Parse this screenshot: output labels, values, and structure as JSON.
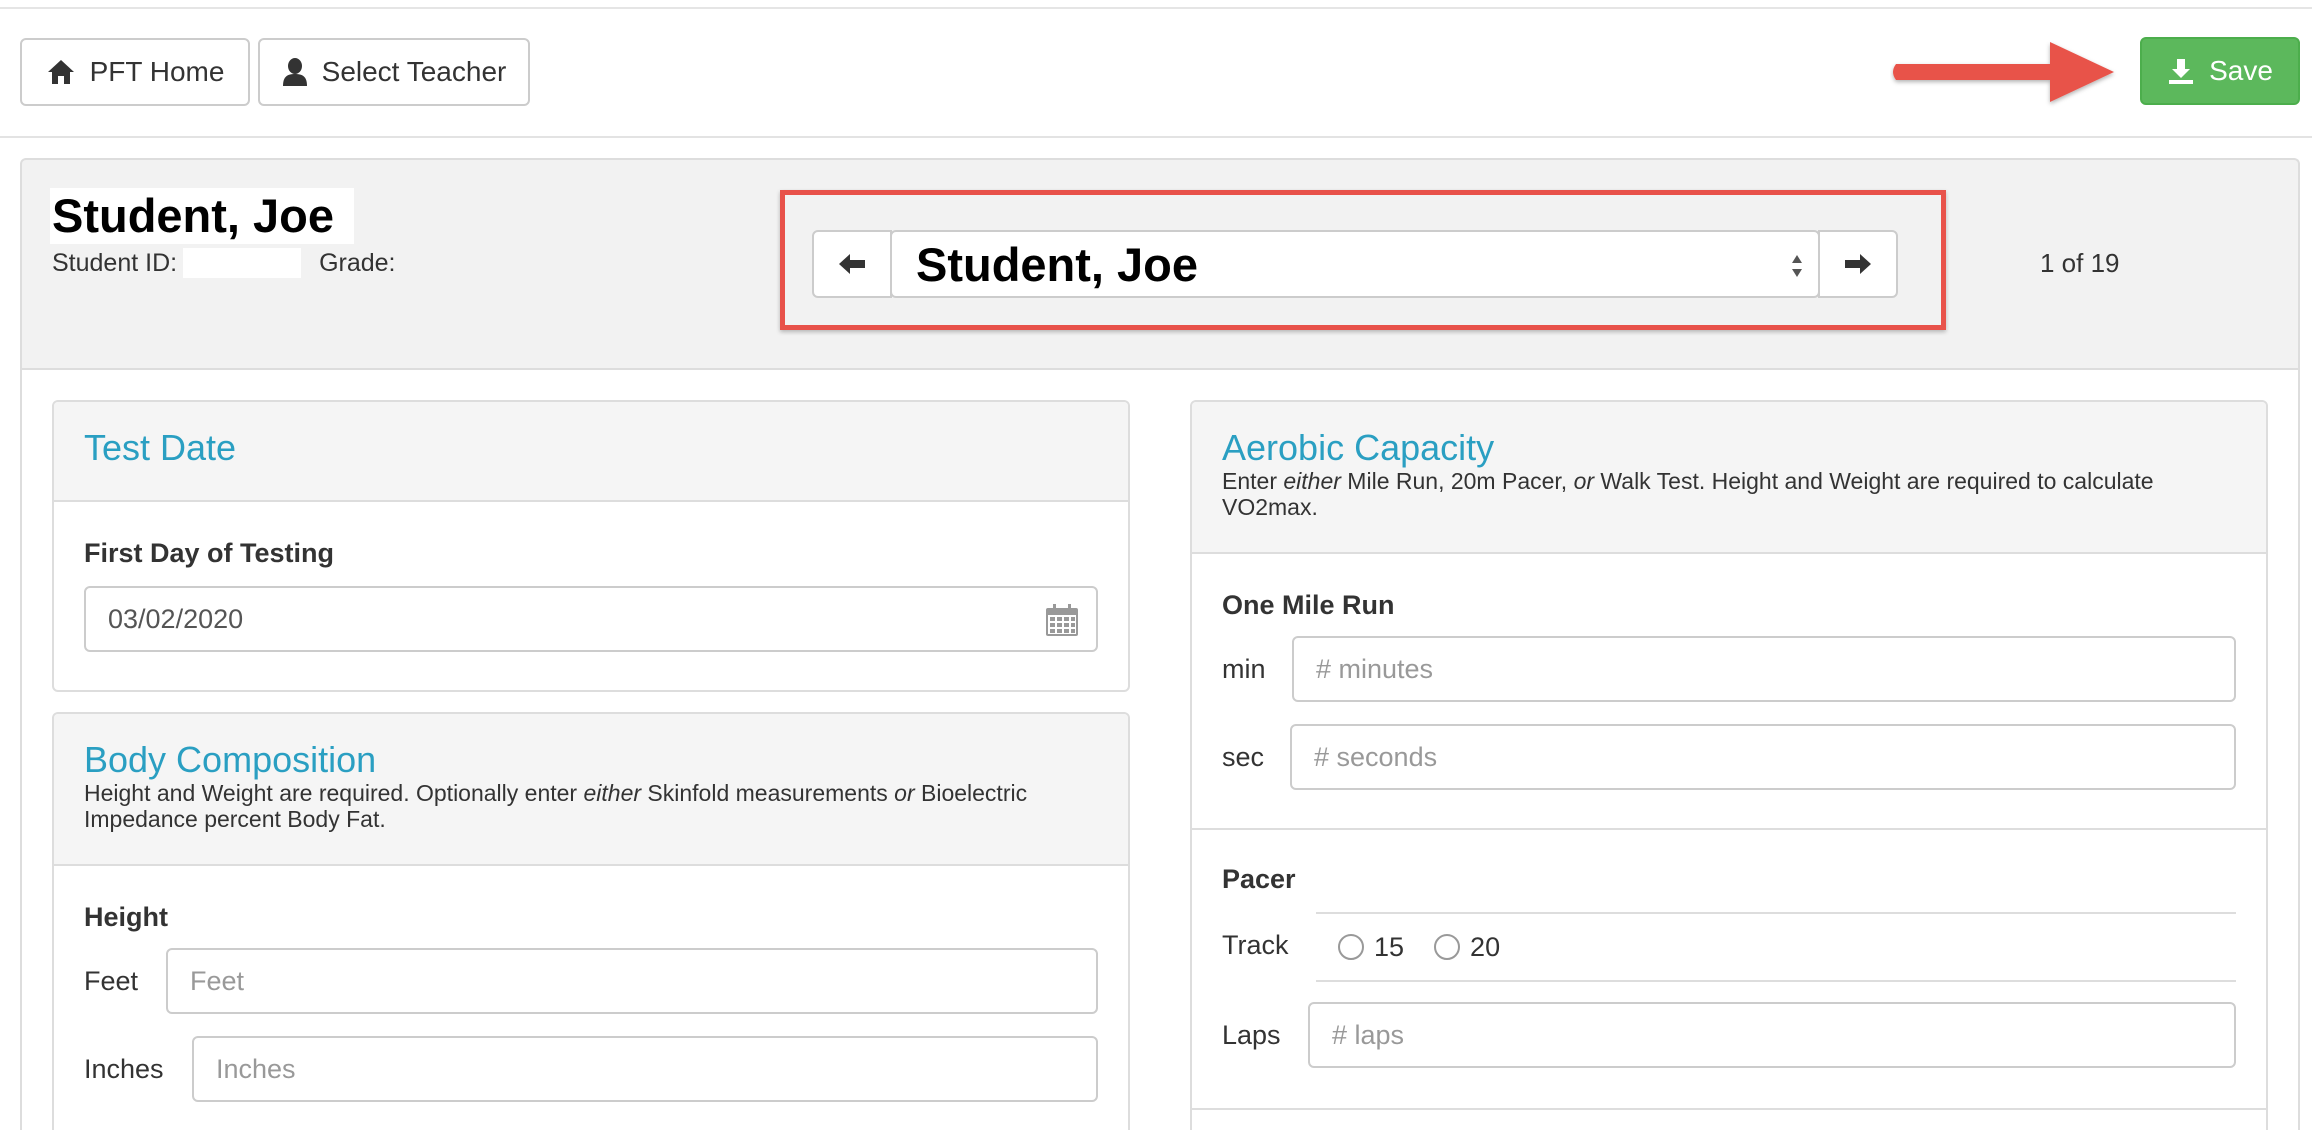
{
  "toolbar": {
    "home_label": "PFT Home",
    "teacher_label": "Select Teacher",
    "save_label": "Save"
  },
  "student": {
    "name": "Student, Joe",
    "id_label": "Student ID:",
    "grade_label": "Grade:",
    "selected_student": "Student, Joe",
    "counter": "1 of 19"
  },
  "test_date": {
    "title": "Test Date",
    "label": "First Day of Testing",
    "value": "03/02/2020"
  },
  "body_composition": {
    "title": "Body Composition",
    "desc_pre": "Height and Weight are required. Optionally enter ",
    "desc_em1": "either",
    "desc_mid": " Skinfold measurements ",
    "desc_em2": "or",
    "desc_post": " Bioelectric Impedance percent Body Fat.",
    "height_label": "Height",
    "feet_label": "Feet",
    "feet_placeholder": "Feet",
    "inches_label": "Inches",
    "inches_placeholder": "Inches"
  },
  "aerobic": {
    "title": "Aerobic Capacity",
    "desc_pre": "Enter ",
    "desc_em1": "either",
    "desc_mid": " Mile Run, 20m Pacer, ",
    "desc_em2": "or",
    "desc_post": " Walk Test. Height and Weight are required to calculate VO2max.",
    "mile_label": "One Mile Run",
    "min_label": "min",
    "min_placeholder": "# minutes",
    "sec_label": "sec",
    "sec_placeholder": "# seconds",
    "pacer_label": "Pacer",
    "track_label": "Track",
    "track_options": [
      "15",
      "20"
    ],
    "laps_label": "Laps",
    "laps_placeholder": "# laps"
  },
  "colors": {
    "accent": "#2a9fc2",
    "save_green": "#5cb85c",
    "annotation_red": "#e8524a"
  },
  "icons": [
    "home-icon",
    "user-icon",
    "download-icon",
    "arrow-left-icon",
    "arrow-right-icon",
    "calendar-icon"
  ]
}
